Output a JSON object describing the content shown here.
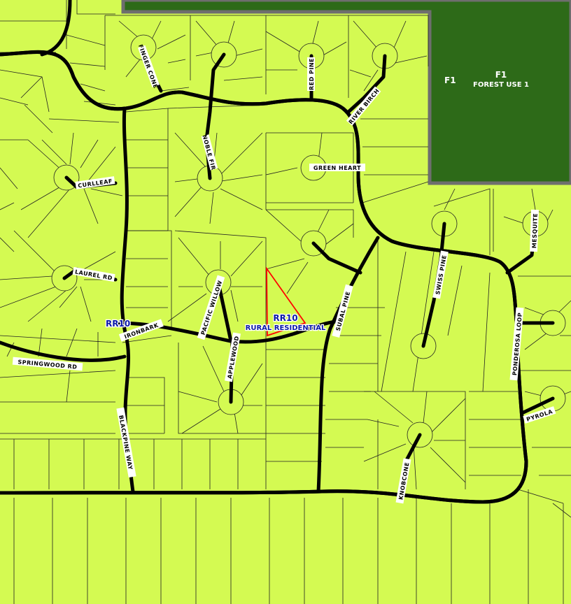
{
  "colors": {
    "land": "#d4fa52",
    "forest": "#2d6a18",
    "forest_border": "#6e6e6e",
    "road": "#000000",
    "label_text": "#0a18a8",
    "highlight": "#ff0000"
  },
  "zones": {
    "forest": {
      "code": "F1",
      "code_large": "F1",
      "name": "FOREST USE 1"
    },
    "residential": {
      "code_left": "RR10",
      "code_center": "RR10",
      "name": "RURAL RESIDENTIAL"
    }
  },
  "roads": {
    "finger_cone": "FINGER CONE",
    "red_pine": "RED PINE",
    "river_birch": "RIVER BIRCH",
    "noble_fir": "NOBLE FIR",
    "green_heart": "GREEN HEART",
    "curlleaf": "CURLLEAF",
    "laurel_rd": "LAUREL RD",
    "pacific_willow": "PACIFIC WILLOW",
    "ironbark": "IRONBARK",
    "applewood": "APPLEWOOD",
    "subal_pine": "SUBAL PINE",
    "swiss_pine": "SWISS PINE",
    "mesquite": "MESQUITE",
    "ponderosa_loop": "PONDEROSA LOOP",
    "springwood_rd": "SPRINGWOOD RD",
    "blackpine_way": "BLACKPINE WAY",
    "pyrola": "PYROLA",
    "knobcone": "KNOBCONE"
  }
}
